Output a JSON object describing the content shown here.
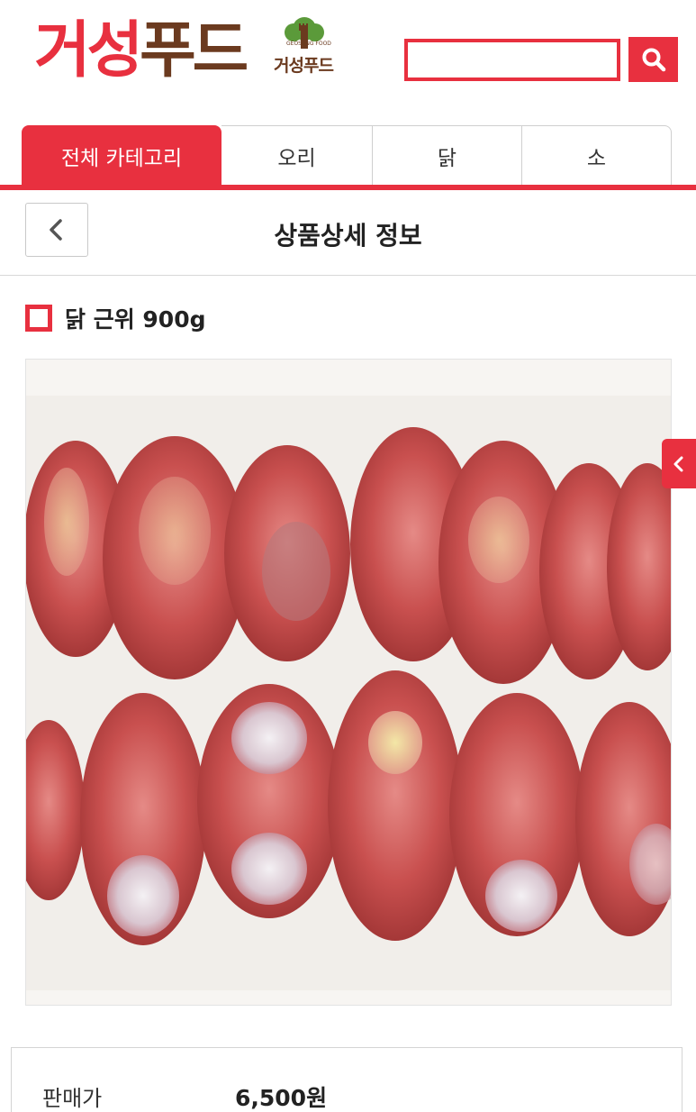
{
  "header": {
    "logo_parts": [
      "거성",
      "푸드"
    ],
    "logo_mark_text": "거성푸드",
    "logo_mark_small": "GEOSUNG FOOD",
    "search_value": "",
    "search_placeholder": ""
  },
  "tabs": [
    {
      "label": "전체 카테고리",
      "active": true
    },
    {
      "label": "오리",
      "active": false
    },
    {
      "label": "닭",
      "active": false
    },
    {
      "label": "소",
      "active": false
    }
  ],
  "titlebar": {
    "title": "상품상세 정보"
  },
  "product": {
    "name": "닭 근위 900g"
  },
  "price": {
    "label": "판매가",
    "value": "6,500원"
  },
  "colors": {
    "accent": "#e8303f",
    "brand_brown": "#6b3a1f",
    "logo_green": "#5b9a3a"
  },
  "icons": {
    "search": "search-icon",
    "back": "chevron-left-icon",
    "side": "chevron-left-icon"
  }
}
